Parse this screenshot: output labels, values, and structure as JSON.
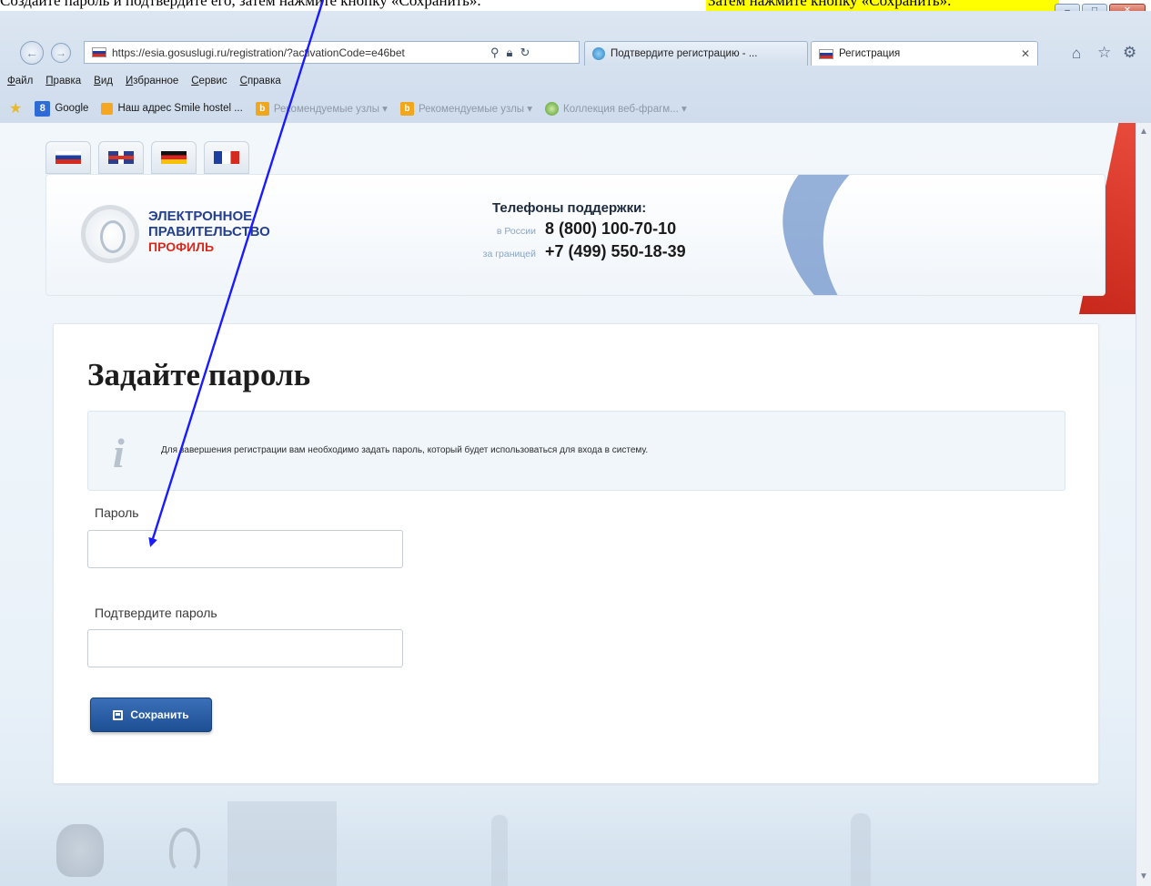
{
  "caption": {
    "text": "Создайте пароль и подтвердите его, затем нажмите кнопку «Сохранить».",
    "highlight": "Затем нажмите кнопку «Сохранить»."
  },
  "browser": {
    "url": "https://esia.gosuslugi.ru/registration/?activationCode=e46bet",
    "tabs": [
      {
        "label": "Подтвердите регистрацию - ..."
      },
      {
        "label": "Регистрация"
      }
    ],
    "menu": [
      "Файл",
      "Правка",
      "Вид",
      "Избранное",
      "Сервис",
      "Справка"
    ],
    "favorites": [
      {
        "label": "Google"
      },
      {
        "label": "Наш адрес Smile hostel ..."
      },
      {
        "label": "Рекомендуемые узлы ▾"
      },
      {
        "label": "Рекомендуемые узлы ▾"
      },
      {
        "label": "Коллекция веб-фрагм... ▾"
      }
    ]
  },
  "header": {
    "logo": {
      "line1": "ЭЛЕКТРОННОЕ",
      "line2": "ПРАВИТЕЛЬСТВО",
      "line3": "ПРОФИЛЬ"
    },
    "support_title": "Телефоны поддержки:",
    "phones": [
      {
        "label": "в России",
        "number": "8 (800) 100-70-10"
      },
      {
        "label": "за границей",
        "number": "+7 (499) 550-18-39"
      }
    ]
  },
  "form": {
    "title": "Задайте пароль",
    "info": "Для завершения регистрации вам необходимо задать пароль, который будет использоваться для входа в систему.",
    "password_label": "Пароль",
    "password_value": "",
    "confirm_label": "Подтвердите пароль",
    "confirm_value": "",
    "save_label": "Сохранить"
  },
  "colors": {
    "arrow": "#1a1aff",
    "highlight": "#ffff00",
    "save_button": "#1c4f94",
    "brand_blue": "#24408e",
    "brand_red": "#d52b1e"
  }
}
